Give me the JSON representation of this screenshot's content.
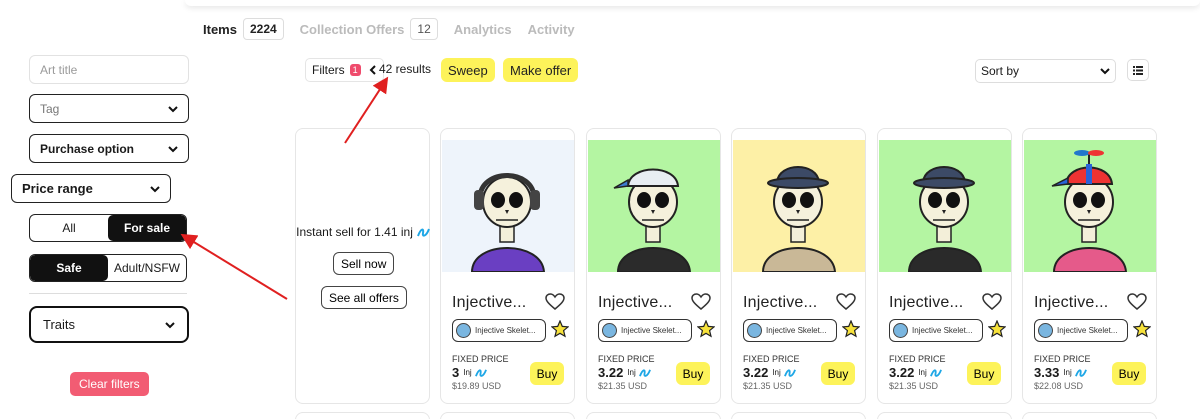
{
  "tabs": [
    {
      "label": "Items",
      "count": "2224"
    },
    {
      "label": "Collection Offers",
      "count": "12"
    },
    {
      "label": "Analytics"
    },
    {
      "label": "Activity"
    }
  ],
  "sidebar": {
    "art_title_placeholder": "Art title",
    "tag_label": "Tag",
    "purchase_label": "Purchase option",
    "price_label": "Price range",
    "sale_toggle": {
      "all": "All",
      "for_sale": "For sale"
    },
    "content_toggle": {
      "safe": "Safe",
      "adult": "Adult/NSFW"
    },
    "traits_label": "Traits",
    "clear_filters": "Clear filters"
  },
  "toolbar": {
    "filters_label": "Filters",
    "filters_badge": "1",
    "results": "42 results",
    "sweep": "Sweep",
    "make_offer": "Make offer",
    "sort_by": "Sort by"
  },
  "offer_card": {
    "instant_sell": "Instant sell for 1.41 inj",
    "sell_now": "Sell now",
    "see_all_offers": "See all offers"
  },
  "nfts": [
    {
      "name": "Injective...",
      "collection": "Injective Skelet...",
      "price_label": "FIXED PRICE",
      "price": "3",
      "unit": "Inj",
      "usd": "$19.89 USD",
      "buy": "Buy",
      "bg": "#eef4fb",
      "hat": "headphones",
      "shirt": "#6a3fc2"
    },
    {
      "name": "Injective...",
      "collection": "Injective Skelet...",
      "price_label": "FIXED PRICE",
      "price": "3.22",
      "unit": "Inj",
      "usd": "$21.35 USD",
      "buy": "Buy",
      "bg": "#b4f5a2",
      "hat": "cap",
      "shirt": "#2b2b2b"
    },
    {
      "name": "Injective...",
      "collection": "Injective Skelet...",
      "price_label": "FIXED PRICE",
      "price": "3.22",
      "unit": "Inj",
      "usd": "$21.35 USD",
      "buy": "Buy",
      "bg": "#fdf0a6",
      "hat": "bucket",
      "shirt": "#c9b897"
    },
    {
      "name": "Injective...",
      "collection": "Injective Skelet...",
      "price_label": "FIXED PRICE",
      "price": "3.22",
      "unit": "Inj",
      "usd": "$21.35 USD",
      "buy": "Buy",
      "bg": "#b4f5a2",
      "hat": "bucket",
      "shirt": "#2a2a2a"
    },
    {
      "name": "Injective...",
      "collection": "Injective Skelet...",
      "price_label": "FIXED PRICE",
      "price": "3.33",
      "unit": "Inj",
      "usd": "$22.08 USD",
      "buy": "Buy",
      "bg": "#b4f5a2",
      "hat": "propeller",
      "shirt": "#e55a8a"
    }
  ],
  "colors": {
    "accent_yellow": "#fdf35a",
    "clear_red": "#f25c73",
    "arrow_red": "#e02020"
  }
}
